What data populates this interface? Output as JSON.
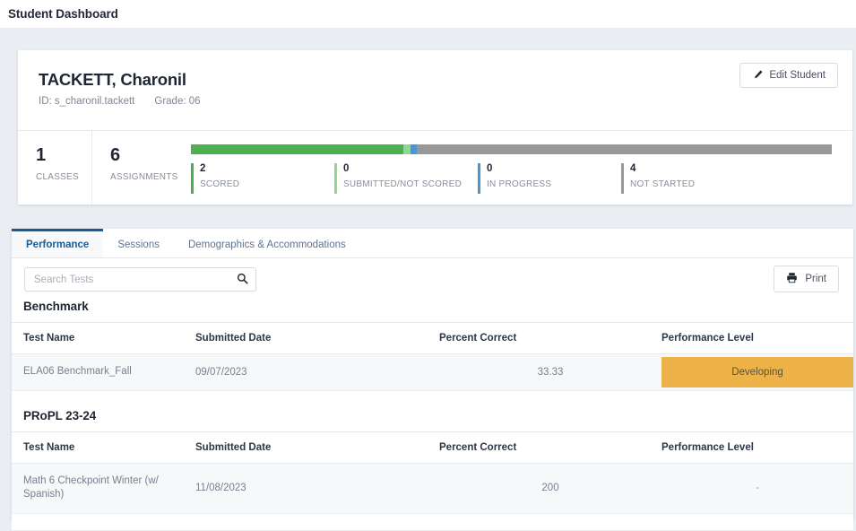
{
  "topbar": {
    "title": "Student Dashboard"
  },
  "student": {
    "name": "TACKETT, Charonil",
    "id_label": "ID: s_charonil.tackett",
    "grade_label": "Grade: 06",
    "edit_button": "Edit Student",
    "edit_icon": "pencil-icon"
  },
  "stats": {
    "classes": {
      "value": "1",
      "label": "CLASSES"
    },
    "assignments": {
      "value": "6",
      "label": "ASSIGNMENTS"
    },
    "breakdown": [
      {
        "value": "2",
        "label": "SCORED",
        "color": "#4caf50",
        "key": "scored"
      },
      {
        "value": "0",
        "label": "SUBMITTED/NOT SCORED",
        "color": "#8ed88f",
        "key": "submitted-not-scored"
      },
      {
        "value": "0",
        "label": "IN PROGRESS",
        "color": "#4b96d2",
        "key": "in-progress"
      },
      {
        "value": "4",
        "label": "NOT STARTED",
        "color": "#989898",
        "key": "not-started"
      }
    ],
    "progress_segments": [
      {
        "key": "scored",
        "color": "#4caf50",
        "percent": 33.2
      },
      {
        "key": "submitted-not-scored",
        "color": "#8ed88f",
        "percent": 1.0
      },
      {
        "key": "in-progress",
        "color": "#4b96d2",
        "percent": 1.0
      },
      {
        "key": "not-started",
        "color": "#989898",
        "percent": 64.8
      }
    ]
  },
  "tabs": [
    {
      "label": "Performance",
      "active": true
    },
    {
      "label": "Sessions",
      "active": false
    },
    {
      "label": "Demographics & Accommodations",
      "active": false
    }
  ],
  "toolbar": {
    "search_placeholder": "Search Tests",
    "search_value": "",
    "search_icon": "search-icon",
    "print_label": "Print",
    "print_icon": "printer-icon"
  },
  "columns": {
    "test_name": "Test Name",
    "submitted_date": "Submitted Date",
    "percent_correct": "Percent Correct",
    "performance_level": "Performance Level"
  },
  "sections": [
    {
      "title": "Benchmark",
      "rows": [
        {
          "test_name": "ELA06 Benchmark_Fall",
          "submitted_date": "09/07/2023",
          "percent_correct": "33.33",
          "performance_level": "Developing",
          "level_color": "#edb349",
          "has_badge": true
        }
      ]
    },
    {
      "title": "PRoPL 23-24",
      "rows": [
        {
          "test_name": "Math 6 Checkpoint Winter (w/ Spanish)",
          "submitted_date": "11/08/2023",
          "percent_correct": "200",
          "performance_level": "-",
          "level_color": "",
          "has_badge": false
        }
      ]
    }
  ],
  "colors": {
    "page_bg": "#eaeef3",
    "accent_blue": "#1b5a93",
    "badge_orange": "#edb349"
  }
}
